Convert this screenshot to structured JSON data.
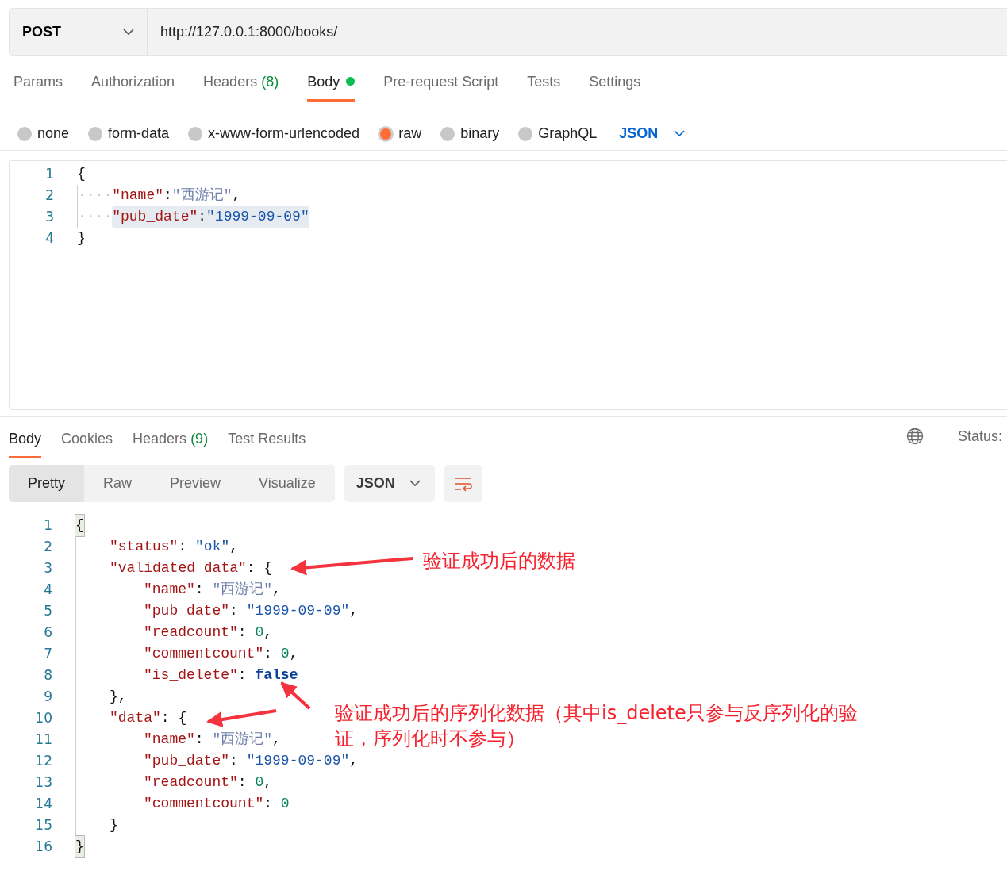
{
  "request": {
    "method": "POST",
    "url": "http://127.0.0.1:8000/books/"
  },
  "request_tabs": [
    {
      "label": "Params",
      "selected": false
    },
    {
      "label": "Authorization",
      "selected": false
    },
    {
      "label": "Headers",
      "count": "(8)",
      "selected": false
    },
    {
      "label": "Body",
      "dot": true,
      "selected": true
    },
    {
      "label": "Pre-request Script",
      "selected": false
    },
    {
      "label": "Tests",
      "selected": false
    },
    {
      "label": "Settings",
      "selected": false
    }
  ],
  "body_types": [
    {
      "label": "none",
      "selected": false
    },
    {
      "label": "form-data",
      "selected": false
    },
    {
      "label": "x-www-form-urlencoded",
      "selected": false
    },
    {
      "label": "raw",
      "selected": true
    },
    {
      "label": "binary",
      "selected": false
    },
    {
      "label": "GraphQL",
      "selected": false
    }
  ],
  "raw_format": "JSON",
  "request_body": [
    {
      "number": "1",
      "highlighted": false,
      "tokens": [
        {
          "kind": "punct",
          "text": "{"
        }
      ],
      "children": [
        {
          "number": "2",
          "highlighted": false,
          "tokens": [
            {
              "kind": "ws",
              "text": "····"
            },
            {
              "kind": "key",
              "text": "\"name\""
            },
            {
              "kind": "punct",
              "text": ":"
            },
            {
              "kind": "cjk",
              "text": "\"西游记\""
            },
            {
              "kind": "punct",
              "text": ","
            }
          ]
        },
        {
          "number": "3",
          "highlighted": true,
          "tokens": [
            {
              "kind": "ws",
              "text": "····"
            },
            {
              "kind": "key",
              "text": "\"pub_date\""
            },
            {
              "kind": "punct",
              "text": ":"
            },
            {
              "kind": "str",
              "text": "\"1999-09-09\""
            }
          ]
        }
      ]
    },
    {
      "number": "4",
      "highlighted": false,
      "tokens": [
        {
          "kind": "punct",
          "text": "}"
        }
      ]
    }
  ],
  "response_tabs": [
    {
      "label": "Body",
      "selected": true
    },
    {
      "label": "Cookies",
      "selected": false
    },
    {
      "label": "Headers",
      "count": "(9)",
      "selected": false
    },
    {
      "label": "Test Results",
      "selected": false
    }
  ],
  "status_label": "Status:",
  "view_modes": [
    {
      "label": "Pretty",
      "selected": true
    },
    {
      "label": "Raw",
      "selected": false
    },
    {
      "label": "Preview",
      "selected": false
    },
    {
      "label": "Visualize",
      "selected": false
    }
  ],
  "response_format": "JSON",
  "response_body": [
    {
      "number": "1",
      "matched": true,
      "tokens": [
        {
          "kind": "punct",
          "text": "{"
        }
      ],
      "children": [
        {
          "number": "2",
          "matched": false,
          "tokens": [
            {
              "kind": "key",
              "text": "\"status\""
            },
            {
              "kind": "punct",
              "text": ": "
            },
            {
              "kind": "str",
              "text": "\"ok\""
            },
            {
              "kind": "punct",
              "text": ","
            }
          ]
        },
        {
          "number": "3",
          "matched": false,
          "tokens": [
            {
              "kind": "key",
              "text": "\"validated_data\""
            },
            {
              "kind": "punct",
              "text": ": {"
            }
          ],
          "children": [
            {
              "number": "4",
              "matched": false,
              "tokens": [
                {
                  "kind": "key",
                  "text": "\"name\""
                },
                {
                  "kind": "punct",
                  "text": ": "
                },
                {
                  "kind": "cjk",
                  "text": "\"西游记\""
                },
                {
                  "kind": "punct",
                  "text": ","
                }
              ]
            },
            {
              "number": "5",
              "matched": false,
              "tokens": [
                {
                  "kind": "key",
                  "text": "\"pub_date\""
                },
                {
                  "kind": "punct",
                  "text": ": "
                },
                {
                  "kind": "str",
                  "text": "\"1999-09-09\""
                },
                {
                  "kind": "punct",
                  "text": ","
                }
              ]
            },
            {
              "number": "6",
              "matched": false,
              "tokens": [
                {
                  "kind": "key",
                  "text": "\"readcount\""
                },
                {
                  "kind": "punct",
                  "text": ": "
                },
                {
                  "kind": "num",
                  "text": "0"
                },
                {
                  "kind": "punct",
                  "text": ","
                }
              ]
            },
            {
              "number": "7",
              "matched": false,
              "tokens": [
                {
                  "kind": "key",
                  "text": "\"commentcount\""
                },
                {
                  "kind": "punct",
                  "text": ": "
                },
                {
                  "kind": "num",
                  "text": "0"
                },
                {
                  "kind": "punct",
                  "text": ","
                }
              ]
            },
            {
              "number": "8",
              "matched": false,
              "tokens": [
                {
                  "kind": "key",
                  "text": "\"is_delete\""
                },
                {
                  "kind": "punct",
                  "text": ": "
                },
                {
                  "kind": "bool",
                  "text": "false"
                }
              ]
            }
          ]
        },
        {
          "number": "9",
          "matched": false,
          "tokens": [
            {
              "kind": "punct",
              "text": "},"
            }
          ]
        },
        {
          "number": "10",
          "matched": false,
          "tokens": [
            {
              "kind": "key",
              "text": "\"data\""
            },
            {
              "kind": "punct",
              "text": ": {"
            }
          ],
          "children": [
            {
              "number": "11",
              "matched": false,
              "tokens": [
                {
                  "kind": "key",
                  "text": "\"name\""
                },
                {
                  "kind": "punct",
                  "text": ": "
                },
                {
                  "kind": "cjk",
                  "text": "\"西游记\""
                },
                {
                  "kind": "punct",
                  "text": ","
                }
              ]
            },
            {
              "number": "12",
              "matched": false,
              "tokens": [
                {
                  "kind": "key",
                  "text": "\"pub_date\""
                },
                {
                  "kind": "punct",
                  "text": ": "
                },
                {
                  "kind": "str",
                  "text": "\"1999-09-09\""
                },
                {
                  "kind": "punct",
                  "text": ","
                }
              ]
            },
            {
              "number": "13",
              "matched": false,
              "tokens": [
                {
                  "kind": "key",
                  "text": "\"readcount\""
                },
                {
                  "kind": "punct",
                  "text": ": "
                },
                {
                  "kind": "num",
                  "text": "0"
                },
                {
                  "kind": "punct",
                  "text": ","
                }
              ]
            },
            {
              "number": "14",
              "matched": false,
              "tokens": [
                {
                  "kind": "key",
                  "text": "\"commentcount\""
                },
                {
                  "kind": "punct",
                  "text": ": "
                },
                {
                  "kind": "num",
                  "text": "0"
                }
              ]
            }
          ]
        },
        {
          "number": "15",
          "matched": false,
          "tokens": [
            {
              "kind": "punct",
              "text": "}"
            }
          ]
        }
      ]
    },
    {
      "number": "16",
      "matched": true,
      "tokens": [
        {
          "kind": "punct",
          "text": "}"
        }
      ]
    }
  ],
  "annotations": [
    {
      "text": "验证成功后的数据"
    },
    {
      "text": "验证成功后的序列化数据（其中is_delete只参与反序列化的验证，序列化时不参与）"
    }
  ]
}
